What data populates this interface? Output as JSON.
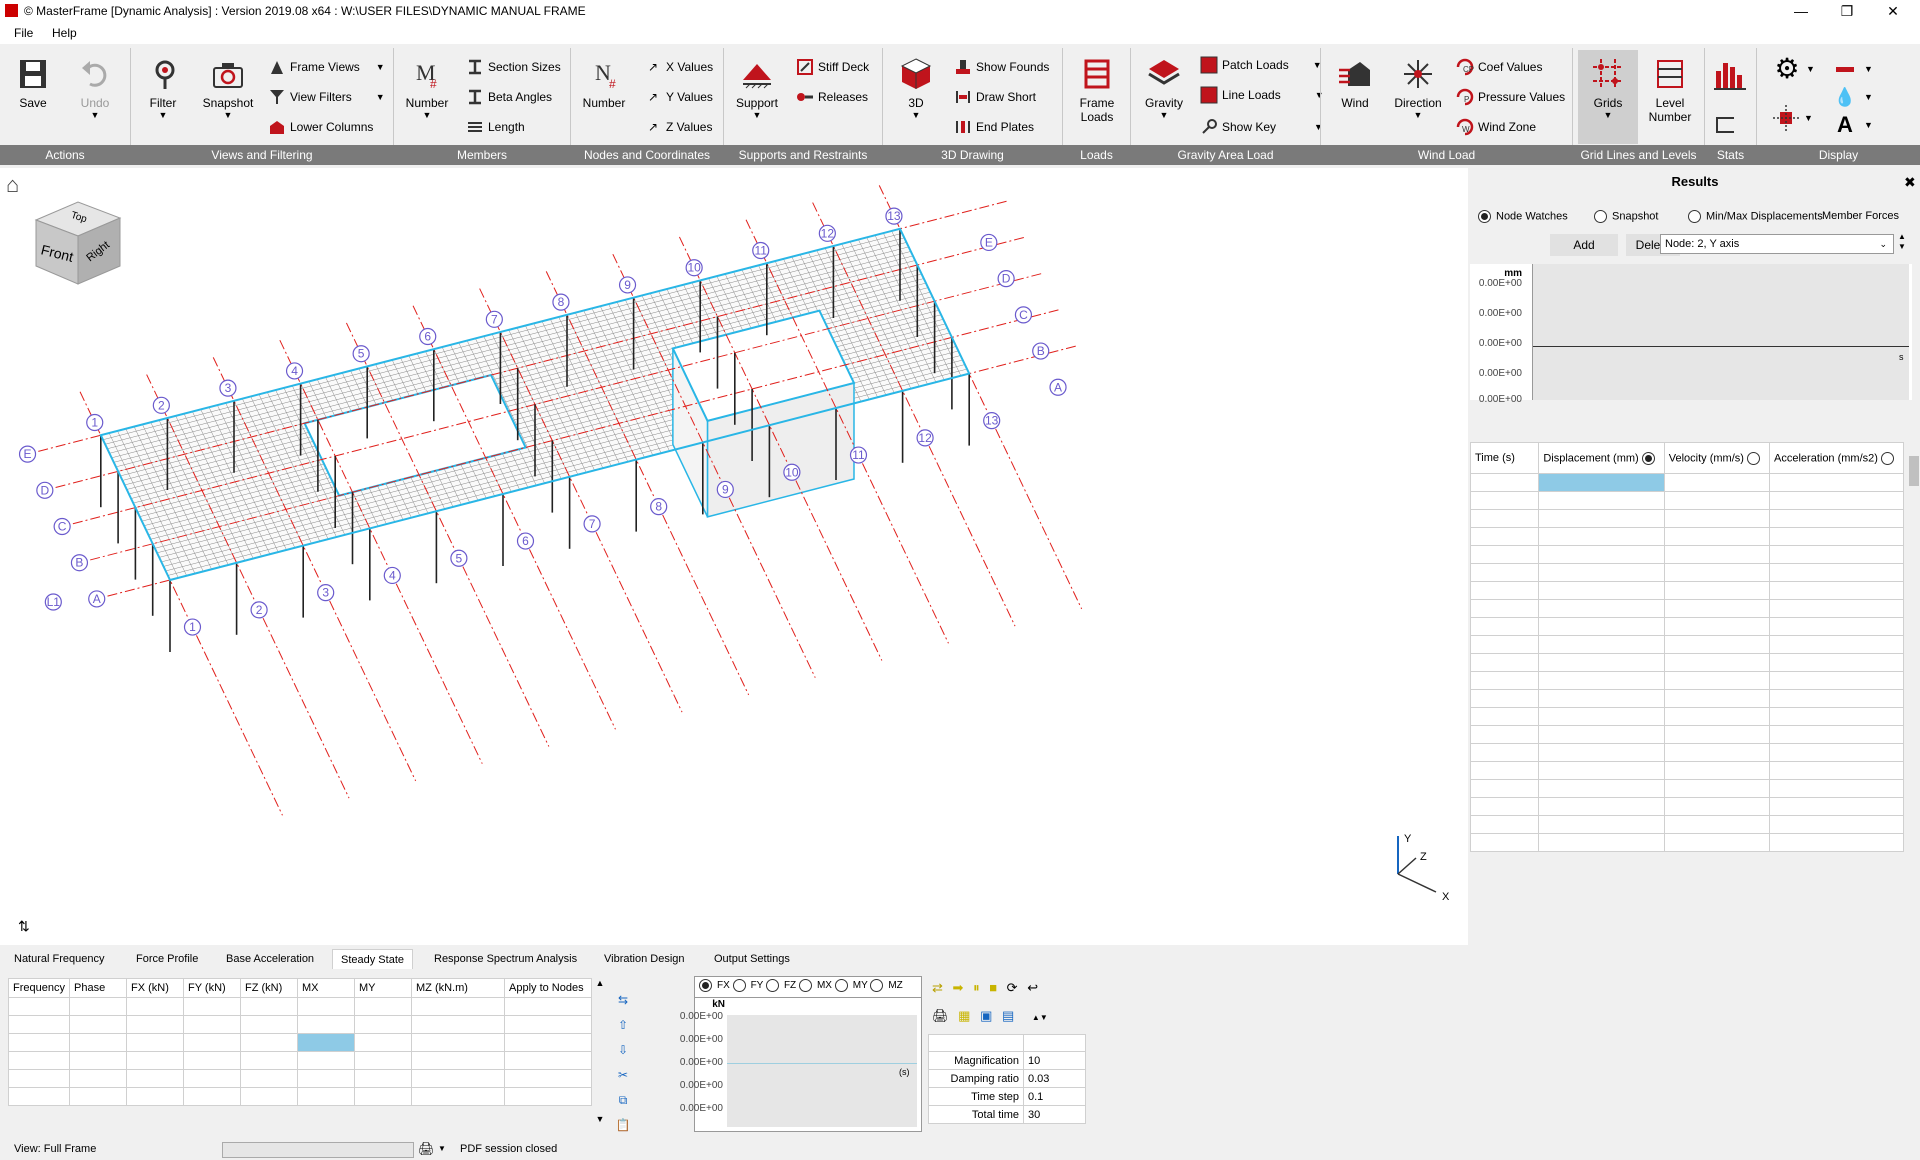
{
  "window": {
    "title": "© MasterFrame [Dynamic Analysis] : Version 2019.08 x64 : W:\\USER FILES\\DYNAMIC MANUAL FRAME",
    "minimize": "—",
    "maximize": "❐",
    "close": "✕"
  },
  "menu": [
    "File",
    "Help"
  ],
  "ribbon": {
    "groups": [
      {
        "label": "Actions"
      },
      {
        "label": "Views and Filtering"
      },
      {
        "label": "Members"
      },
      {
        "label": "Nodes and Coordinates"
      },
      {
        "label": "Supports and Restraints"
      },
      {
        "label": "3D Drawing"
      },
      {
        "label": "Loads"
      },
      {
        "label": "Gravity Area Load"
      },
      {
        "label": "Wind Load"
      },
      {
        "label": "Grid Lines and Levels"
      },
      {
        "label": "Stats"
      },
      {
        "label": "Display"
      }
    ],
    "buttons": {
      "save": "Save",
      "undo": "Undo",
      "filter": "Filter",
      "snapshot": "Snapshot",
      "frame_views": "Frame Views",
      "view_filters": "View Filters",
      "lower_columns": "Lower Columns",
      "member_number": "Number",
      "section_sizes": "Section Sizes",
      "beta_angles": "Beta Angles",
      "length": "Length",
      "node_number": "Number",
      "x_values": "X Values",
      "y_values": "Y Values",
      "z_values": "Z Values",
      "support": "Support",
      "stiff_deck": "Stiff Deck",
      "releases": "Releases",
      "three_d": "3D",
      "show_founds": "Show Founds",
      "draw_short": "Draw Short",
      "end_plates": "End Plates",
      "frame_loads_1": "Frame",
      "frame_loads_2": "Loads",
      "gravity": "Gravity",
      "patch_loads": "Patch Loads",
      "line_loads": "Line Loads",
      "show_key": "Show Key",
      "wind": "Wind",
      "direction": "Direction",
      "coef_values": "Coef Values",
      "pressure_values": "Pressure Values",
      "wind_zone": "Wind Zone",
      "grids": "Grids",
      "level_number_1": "Level",
      "level_number_2": "Number"
    }
  },
  "viewcube": {
    "top": "Top",
    "front": "Front",
    "right": "Right"
  },
  "axes": {
    "x": "X",
    "y": "Y",
    "z": "Z"
  },
  "gridlines": {
    "numbers": [
      "1",
      "2",
      "3",
      "4",
      "5",
      "6",
      "7",
      "8",
      "9",
      "10",
      "11",
      "12",
      "13"
    ],
    "letters": [
      "A",
      "B",
      "C",
      "D",
      "E"
    ],
    "extra": "L1"
  },
  "results": {
    "title": "Results",
    "close": "✖",
    "modes": [
      {
        "label": "Node Watches",
        "selected": true
      },
      {
        "label": "Snapshot",
        "selected": false
      },
      {
        "label": "Min/Max Displacements",
        "selected": false
      }
    ],
    "member_forces": "Member Forces",
    "add": "Add",
    "delete": "Delete",
    "node_select": "Node: 2, Y axis",
    "chart_unit": "mm",
    "chart_xunit": "s",
    "chart_ticks": [
      "0.00E+00",
      "0.00E+00",
      "0.00E+00",
      "0.00E+00",
      "0.00E+00"
    ],
    "columns": [
      "Time (s)",
      "Displacement (mm)",
      "Velocity (mm/s)",
      "Acceleration (mm/s2)"
    ]
  },
  "bottom_tabs": [
    {
      "label": "Natural Frequency",
      "active": false
    },
    {
      "label": "Force Profile",
      "active": false
    },
    {
      "label": "Base Acceleration",
      "active": false
    },
    {
      "label": "Steady State",
      "active": true
    },
    {
      "label": "Response Spectrum Analysis",
      "active": false
    },
    {
      "label": "Vibration Design",
      "active": false
    },
    {
      "label": "Output Settings",
      "active": false
    }
  ],
  "steady_state": {
    "columns": [
      "Frequency",
      "Phase",
      "FX (kN)",
      "FY (kN)",
      "FZ (kN)",
      "MX",
      "MY",
      "MZ (kN.m)",
      "Apply to Nodes"
    ],
    "chart_radios": [
      {
        "label": "FX",
        "selected": true
      },
      {
        "label": "FY",
        "selected": false
      },
      {
        "label": "FZ",
        "selected": false
      },
      {
        "label": "MX",
        "selected": false
      },
      {
        "label": "MY",
        "selected": false
      },
      {
        "label": "MZ",
        "selected": false
      }
    ],
    "chart_unit": "kN",
    "chart_xunit": "(s)",
    "chart_ticks": [
      "0.00E+00",
      "0.00E+00",
      "0.00E+00",
      "0.00E+00",
      "0.00E+00"
    ],
    "params": [
      {
        "label": "Magnification",
        "value": "10"
      },
      {
        "label": "Damping ratio",
        "value": "0.03"
      },
      {
        "label": "Time step",
        "value": "0.1"
      },
      {
        "label": "Total time",
        "value": "30"
      }
    ]
  },
  "status": {
    "view": "View: Full Frame",
    "pdf": "PDF session closed"
  },
  "colors": {
    "brand_red": "#c0141c",
    "mesh_cyan": "#29b6e6",
    "grid_red": "#e0201c",
    "grid_bubble": "#6a5acd",
    "selected_cell": "#8ecae6",
    "ribbon_label_bg": "#7a7a7a"
  }
}
